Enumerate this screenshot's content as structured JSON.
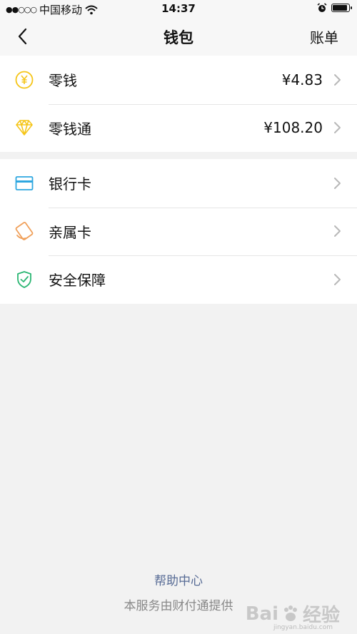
{
  "status_bar": {
    "signal": "●●○○○",
    "carrier": "中国移动",
    "time": "14:37"
  },
  "nav": {
    "title": "钱包",
    "action": "账单"
  },
  "groups": {
    "balance": [
      {
        "label": "零钱",
        "value": "¥4.83",
        "icon": "yuan-coin-icon",
        "color": "#f5c518"
      },
      {
        "label": "零钱通",
        "value": "¥108.20",
        "icon": "diamond-icon",
        "color": "#f5c518"
      }
    ],
    "services": [
      {
        "label": "银行卡",
        "icon": "bank-card-icon",
        "color": "#2ea7e0"
      },
      {
        "label": "亲属卡",
        "icon": "family-card-icon",
        "color": "#f0a05a"
      },
      {
        "label": "安全保障",
        "icon": "shield-check-icon",
        "color": "#2bb673"
      }
    ]
  },
  "footer": {
    "help": "帮助中心",
    "provider": "本服务由财付通提供"
  },
  "watermark": {
    "brand": "Bai",
    "brand2": "经验",
    "url": "jingyan.baidu.com"
  }
}
